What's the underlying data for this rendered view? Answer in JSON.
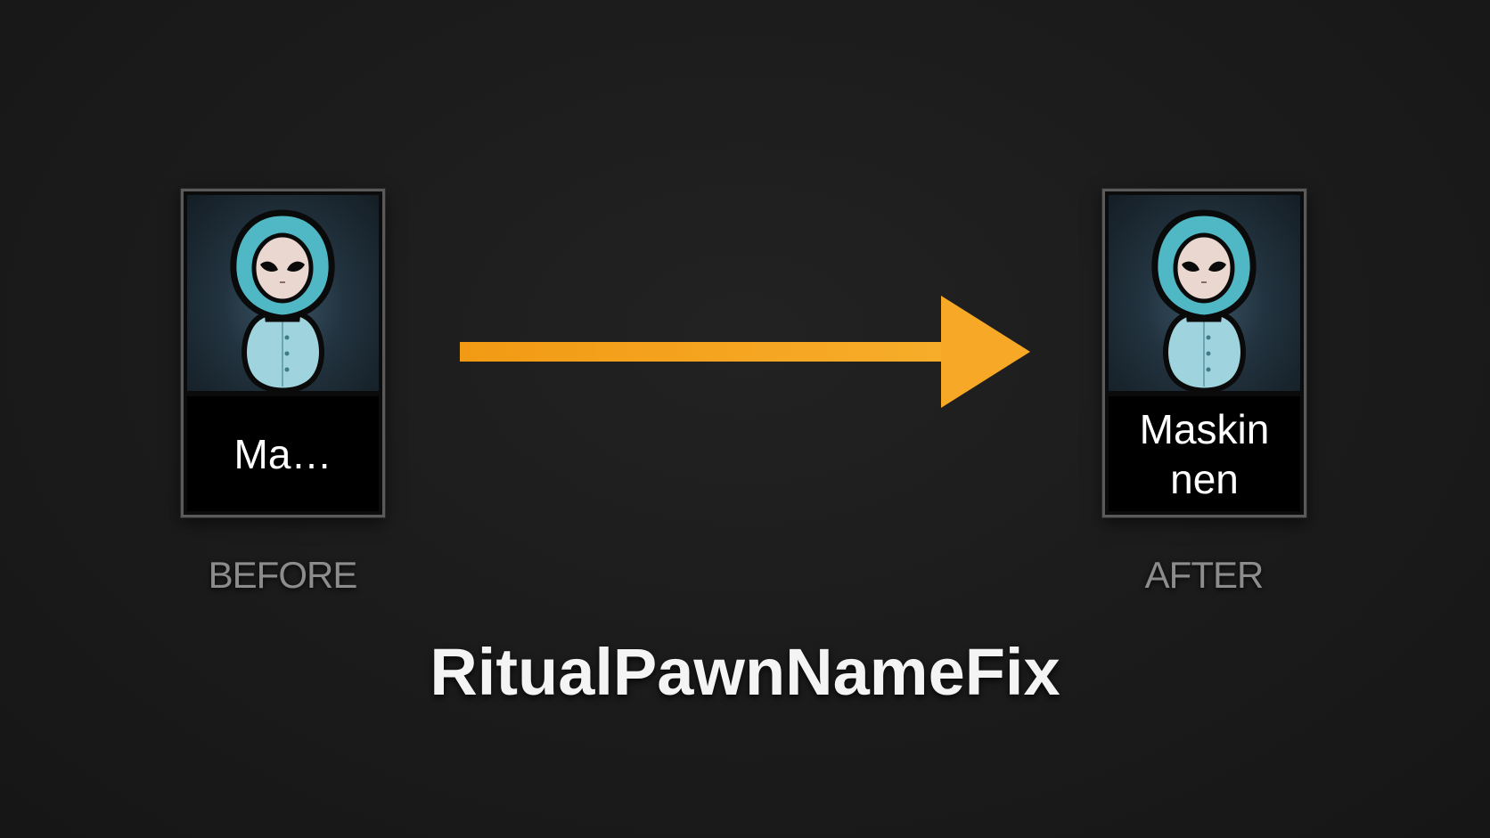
{
  "before": {
    "name": "Ma…",
    "caption": "BEFORE"
  },
  "after": {
    "name": "Maskin\nnen",
    "caption": "AFTER"
  },
  "arrow": {
    "icon": "arrow-right-icon",
    "color": "#f4a11a"
  },
  "title": "RitualPawnNameFix",
  "colors": {
    "background": "#1c1c1c",
    "hood": "#4fb8c4",
    "caption": "#8c8c8c"
  }
}
